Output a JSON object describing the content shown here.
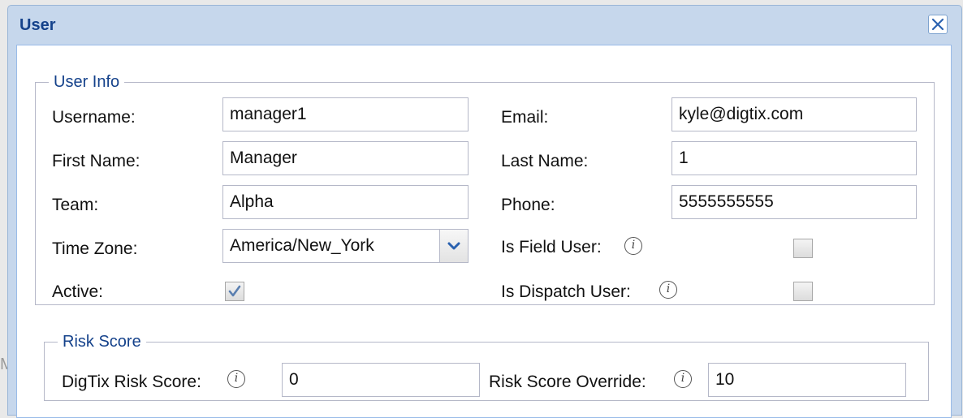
{
  "background_glyph": "M",
  "window": {
    "title": "User"
  },
  "user_info": {
    "legend": "User Info",
    "username": {
      "label": "Username:",
      "value": "manager1"
    },
    "email": {
      "label": "Email:",
      "value": "kyle@digtix.com"
    },
    "first_name": {
      "label": "First Name:",
      "value": "Manager"
    },
    "last_name": {
      "label": "Last Name:",
      "value": "1"
    },
    "team": {
      "label": "Team:",
      "value": "Alpha"
    },
    "phone": {
      "label": "Phone:",
      "value": "5555555555"
    },
    "time_zone": {
      "label": "Time Zone:",
      "value": "America/New_York"
    },
    "is_field_user": {
      "label": "Is Field User:",
      "checked": false
    },
    "active": {
      "label": "Active:",
      "checked": true
    },
    "is_dispatch_user": {
      "label": "Is Dispatch User:",
      "checked": false
    }
  },
  "risk_score": {
    "legend": "Risk Score",
    "digtix_risk_score": {
      "label": "DigTix Risk Score:",
      "value": "0"
    },
    "risk_score_override": {
      "label": "Risk Score Override:",
      "value": "10"
    }
  },
  "icons": {
    "info": "info-icon",
    "close": "close-icon",
    "dropdown": "chevron-down-icon",
    "check": "check-icon"
  },
  "colors": {
    "title_blue": "#15428b",
    "header_bg": "#c6d7ec",
    "border_blue": "#99bbe8"
  }
}
